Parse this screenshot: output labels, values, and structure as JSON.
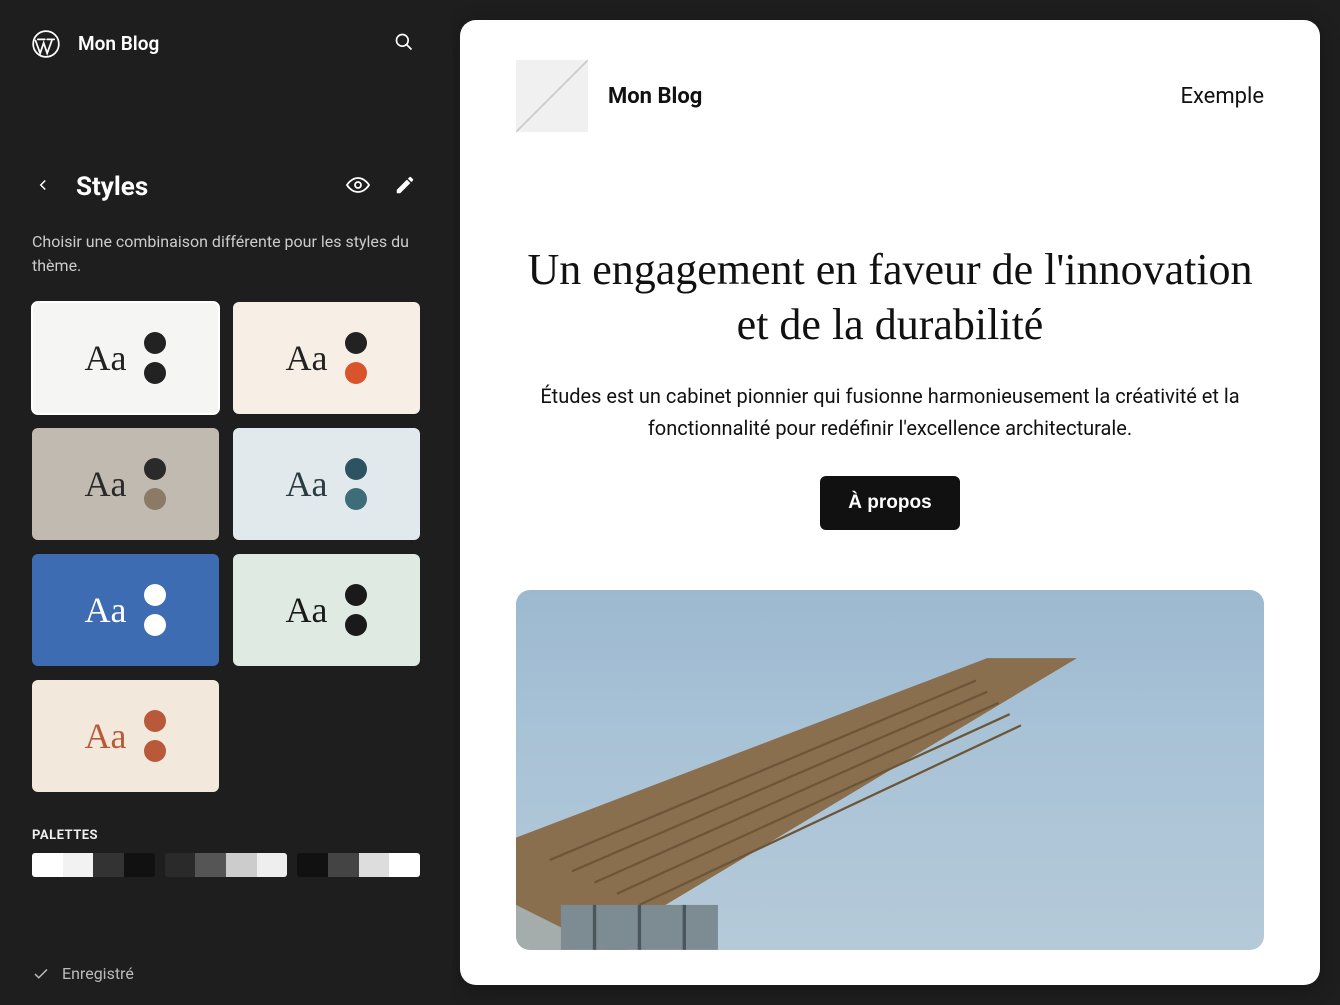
{
  "app": {
    "site_title": "Mon Blog"
  },
  "panel": {
    "title": "Styles",
    "description": "Choisir une combinaison différente pour les styles du thème.",
    "palettes_label": "PALETTES"
  },
  "variations": [
    {
      "bg": "#f5f5f4",
      "text": "#222",
      "dot1": "#222",
      "dot2": "#222",
      "selected": true
    },
    {
      "bg": "#f7efe6",
      "text": "#222",
      "dot1": "#222",
      "dot2": "#d9542b",
      "selected": false
    },
    {
      "bg": "#c0bab0",
      "text": "#2a2a2a",
      "dot1": "#2a2a2a",
      "dot2": "#8a7a66",
      "selected": false
    },
    {
      "bg": "#e1e9ec",
      "text": "#2a3b42",
      "dot1": "#2d5362",
      "dot2": "#3e6d7a",
      "selected": false
    },
    {
      "bg": "#3d6cb3",
      "text": "#fff",
      "dot1": "#fff",
      "dot2": "#fff",
      "selected": false
    },
    {
      "bg": "#dfeae3",
      "text": "#1a1a1a",
      "dot1": "#1a1a1a",
      "dot2": "#1a1a1a",
      "selected": false
    },
    {
      "bg": "#f2e8dc",
      "text": "#b85a3a",
      "dot1": "#b85a3a",
      "dot2": "#b85a3a",
      "selected": false
    }
  ],
  "palettes": [
    [
      "#ffffff",
      "#f2f2f2",
      "#333333",
      "#111111"
    ],
    [
      "#2a2a2a",
      "#555555",
      "#cccccc",
      "#eeeeee"
    ],
    [
      "#111111",
      "#444444",
      "#dddddd",
      "#ffffff"
    ]
  ],
  "footer": {
    "saved_label": "Enregistré"
  },
  "preview": {
    "site_title": "Mon Blog",
    "nav_item": "Exemple",
    "heading": "Un engagement en faveur de l'innovation et de la durabilité",
    "sub": "Études est un cabinet pionnier qui fusionne harmonieusement la créativité et la fonctionnalité pour redéfinir l'excellence architecturale.",
    "cta": "À propos"
  }
}
